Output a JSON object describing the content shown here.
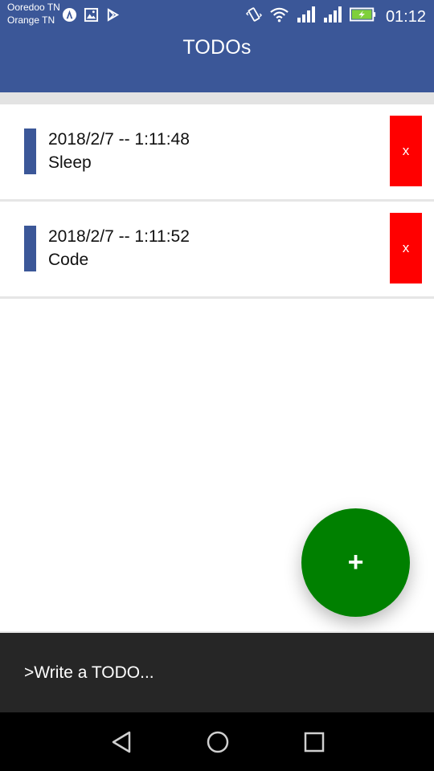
{
  "status_bar": {
    "carriers": [
      "Ooredoo TN",
      "Orange TN"
    ],
    "left_icons": [
      "android-icon",
      "image-icon",
      "play-store-icon"
    ],
    "right_icons": [
      "vibrate-icon",
      "wifi-icon",
      "signal-icon",
      "signal-icon",
      "battery-charging-icon"
    ],
    "time": "01:12"
  },
  "app_bar": {
    "title": "TODOs"
  },
  "todos": [
    {
      "date": "2018/2/7 -- 1:11:48",
      "text": "Sleep",
      "delete_label": "x"
    },
    {
      "date": "2018/2/7 -- 1:11:52",
      "text": "Code",
      "delete_label": "x"
    }
  ],
  "fab": {
    "label": "+"
  },
  "input": {
    "placeholder": ">Write a TODO...",
    "value": ""
  },
  "nav": {
    "icons": [
      "back-icon",
      "home-icon",
      "recents-icon"
    ]
  },
  "colors": {
    "primary": "#3b5798",
    "delete": "#ff0000",
    "fab": "#008000",
    "input_bar": "#262626"
  }
}
